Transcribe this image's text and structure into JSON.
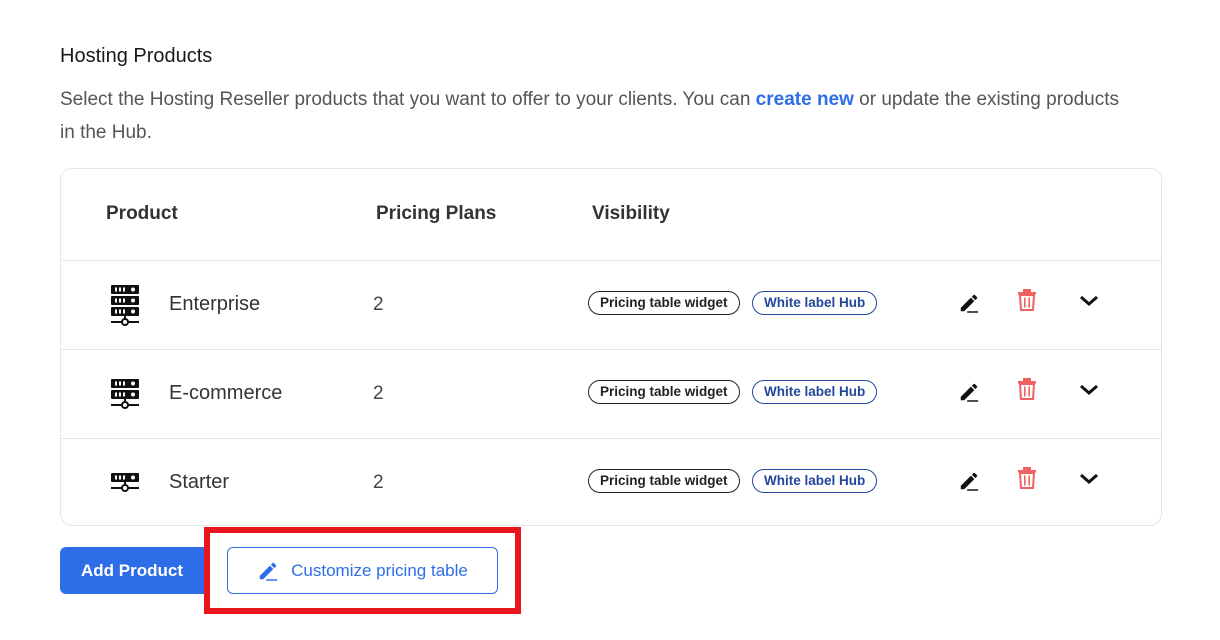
{
  "section": {
    "title": "Hosting Products",
    "description_before": "Select the Hosting Reseller products that you want to offer to your clients. You can ",
    "description_link": "create new",
    "description_after": " or update the existing products in the Hub."
  },
  "table": {
    "headers": {
      "product": "Product",
      "plans": "Pricing Plans",
      "visibility": "Visibility"
    },
    "rows": [
      {
        "icon": "server-stack-3-icon",
        "name": "Enterprise",
        "plans": "2",
        "badges": [
          "Pricing table widget",
          "White label Hub"
        ]
      },
      {
        "icon": "server-stack-2-icon",
        "name": "E-commerce",
        "plans": "2",
        "badges": [
          "Pricing table widget",
          "White label Hub"
        ]
      },
      {
        "icon": "server-stack-1-icon",
        "name": "Starter",
        "plans": "2",
        "badges": [
          "Pricing table widget",
          "White label Hub"
        ]
      }
    ]
  },
  "actions": {
    "add_product": "Add Product",
    "customize_pricing_table": "Customize pricing table"
  },
  "colors": {
    "accent": "#2d6ee8",
    "delete": "#f06262",
    "hub_badge": "#23479b",
    "highlight": "#e8161c"
  }
}
